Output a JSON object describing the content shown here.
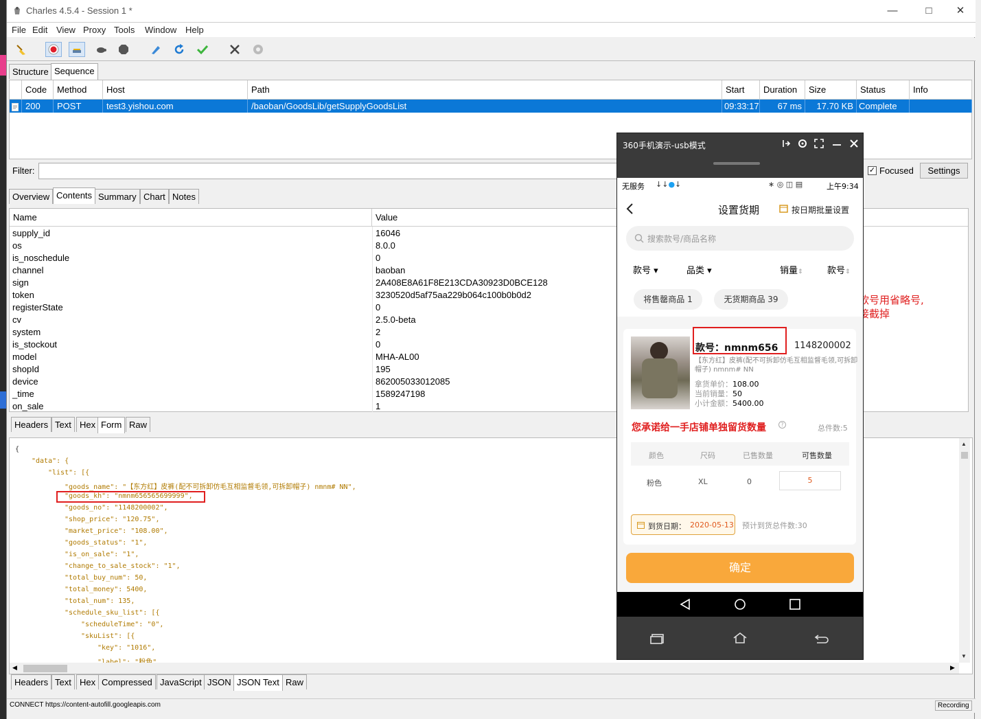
{
  "app": {
    "title": "Charles 4.5.4 - Session 1 *"
  },
  "menu": [
    "File",
    "Edit",
    "View",
    "Proxy",
    "Tools",
    "Window",
    "Help"
  ],
  "top_tabs": [
    "Structure",
    "Sequence"
  ],
  "columns": [
    "Code",
    "Method",
    "Host",
    "Path",
    "Start",
    "Duration",
    "Size",
    "Status",
    "Info"
  ],
  "request": {
    "code": "200",
    "method": "POST",
    "host": "test3.yishou.com",
    "path": "/baoban/GoodsLib/getSupplyGoodsList",
    "start": "09:33:17",
    "duration": "67 ms",
    "size": "17.70 KB",
    "status": "Complete",
    "info": ""
  },
  "filter": {
    "label": "Filter:",
    "focused_label": "Focused",
    "settings_label": "Settings"
  },
  "detail_tabs": [
    "Overview",
    "Contents",
    "Summary",
    "Chart",
    "Notes"
  ],
  "kv_headers": {
    "name": "Name",
    "value": "Value"
  },
  "kv_rows": [
    {
      "k": "supply_id",
      "v": "16046"
    },
    {
      "k": "os",
      "v": "8.0.0"
    },
    {
      "k": "is_noschedule",
      "v": "0"
    },
    {
      "k": "channel",
      "v": "baoban"
    },
    {
      "k": "sign",
      "v": "2A408E8A61F8E213CDA30923D0BCE128"
    },
    {
      "k": "token",
      "v": "3230520d5af75aa229b064c100b0b0d2"
    },
    {
      "k": "registerState",
      "v": "0"
    },
    {
      "k": "cv",
      "v": "2.5.0-beta"
    },
    {
      "k": "system",
      "v": "2"
    },
    {
      "k": "is_stockout",
      "v": "0"
    },
    {
      "k": "model",
      "v": "MHA-AL00"
    },
    {
      "k": "shopId",
      "v": "195"
    },
    {
      "k": "device",
      "v": "862005033012085"
    },
    {
      "k": "_time",
      "v": "1589247198"
    },
    {
      "k": "on_sale",
      "v": "1"
    }
  ],
  "request_tabs": [
    "Headers",
    "Text",
    "Hex",
    "Form",
    "Raw"
  ],
  "json_lines": [
    "{",
    "\"data\": {",
    "\"list\": [{",
    "\"goods_name\": \"【东方红】皮裤(配不可拆卸仿毛互相监督毛领,可拆卸帽子)  nmnm#  NN\",",
    "\"goods_kh\": \"nmnm656565699999\",",
    "\"goods_no\": \"1148200002\",",
    "\"shop_price\": \"120.75\",",
    "\"market_price\": \"108.00\",",
    "\"goods_status\": \"1\",",
    "\"is_on_sale\": \"1\",",
    "\"change_to_sale_stock\": \"1\",",
    "\"total_buy_num\": 50,",
    "\"total_money\": 5400,",
    "\"total_num\": 135,",
    "\"schedule_sku_list\": [{",
    "\"scheduleTime\": \"0\",",
    "\"skuList\": [{",
    "\"key\": \"1016\",",
    "\"label\": \"粉色\","
  ],
  "response_tabs": [
    "Headers",
    "Text",
    "Hex",
    "Compressed",
    "JavaScript",
    "JSON",
    "JSON Text",
    "Raw"
  ],
  "status": {
    "text": "CONNECT https://content-autofill.googleapis.com",
    "recording": "Recording"
  },
  "phone": {
    "window_title": "360手机演示-usb模式",
    "status_left": "无服务",
    "status_time": "上午9:34",
    "page_title": "设置货期",
    "batch_label": "按日期批量设置",
    "search_placeholder": "搜索款号/商品名称",
    "filters": [
      "款号",
      "品类",
      "销量",
      "款号"
    ],
    "chips": [
      "将售罄商品 1",
      "无货期商品 39"
    ],
    "kh_label": "款号：nmnm656",
    "goods_no": "1148200002",
    "goods_desc": "【东方红】皮裤(配不可拆卸仿毛互相监督毛领,可拆卸帽子) nmnm# NN",
    "price_rows": [
      {
        "label": "拿货单价：",
        "value": "108.00"
      },
      {
        "label": "当前销量：",
        "value": "50"
      },
      {
        "label": "小计金额：",
        "value": "5400.00"
      }
    ],
    "commit_title": "您承诺给一手店铺单独留货数量",
    "total_label": "总件数:5",
    "sku_headers": [
      "颜色",
      "尺码",
      "已售数量",
      "可售数量"
    ],
    "sku_row": [
      "粉色",
      "XL",
      "0",
      "5"
    ],
    "arrival_label": "到货日期：",
    "arrival_date": "2020-05-13",
    "expected": "预计到货总件数:30",
    "confirm": "确定"
  },
  "annotation": {
    "line1": "过长的款号用省略号,",
    "line2": "不要直接截掉"
  },
  "colors": {
    "selection": "#0b78d7",
    "annotation": "#e02020",
    "confirm": "#f9a83b"
  }
}
